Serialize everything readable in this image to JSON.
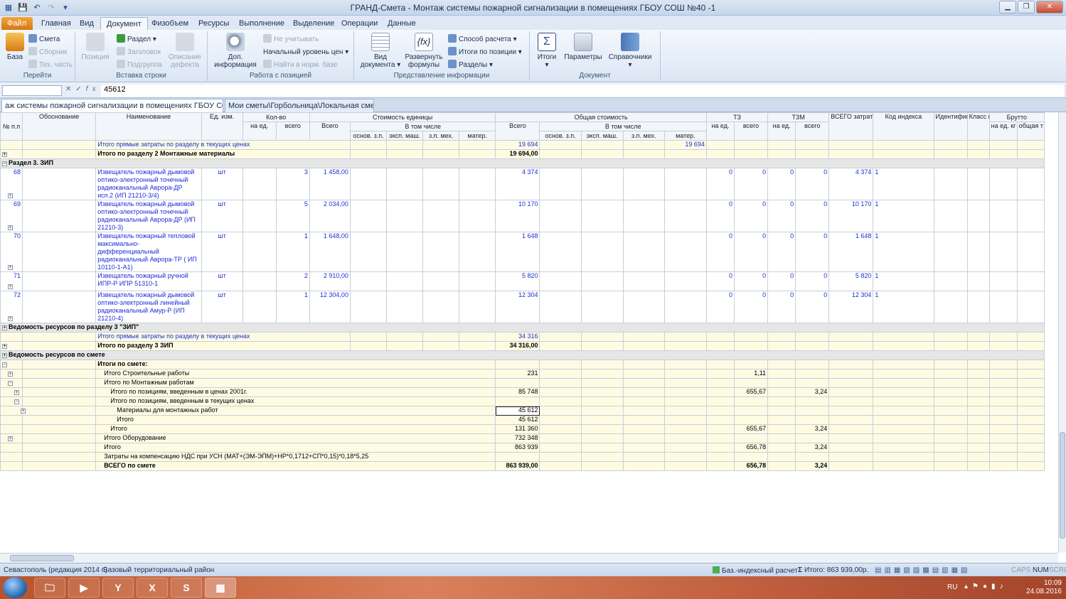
{
  "window": {
    "title": "ГРАНД-Смета - Монтаж системы пожарной сигнализации в помещениях ГБОУ СОШ №40 -1"
  },
  "menu": {
    "tabs": [
      "Файл",
      "Главная",
      "Вид",
      "Документ",
      "Физобъем",
      "Ресурсы",
      "Выполнение",
      "Выделение",
      "Операции",
      "Данные"
    ]
  },
  "ribbon": {
    "go": {
      "title": "Перейти",
      "baza": "База",
      "smeta": "Смета",
      "sbornik": "Сборник",
      "teh": "Тех. часть"
    },
    "insert": {
      "title": "Вставка строки",
      "position": "Позиция",
      "razdel": "Раздел",
      "zagolovok": "Заголовок",
      "podgruppa": "Подгруппа",
      "opisanie1": "Описание",
      "opisanie2": "дефекта"
    },
    "work": {
      "title": "Работа с позицией",
      "dop1": "Доп.",
      "dop2": "информация",
      "neuchit": "Не учитывать",
      "uroven": "Начальный уровень цен",
      "nayti": "Найти в норм. базе"
    },
    "view": {
      "title": "Представление информации",
      "vid1": "Вид",
      "vid2": "документа",
      "razv1": "Развернуть",
      "razv2": "формулы",
      "sposob": "Способ расчета",
      "itogi_pos": "Итоги по позиции",
      "razdely": "Разделы"
    },
    "doc": {
      "title": "Документ",
      "itogi": "Итоги",
      "params": "Параметры",
      "sprav": "Справочники"
    }
  },
  "formula": {
    "value": "45612"
  },
  "doc_tabs": [
    {
      "label": "аж системы пожарной сигнализации в помещениях ГБОУ СОШ №"
    },
    {
      "label": "Мои сметы\\Горбольница\\Локальная смета"
    }
  ],
  "headers": {
    "num": "№ п.п",
    "obosn": "Обоснование",
    "naim": "Наименование",
    "ed": "Ед. изм.",
    "kolvo": "Кол-во",
    "na_ed": "на ед.",
    "vsego": "всего",
    "stoim_ed": "Стоимость единицы",
    "vsego_cap": "Всего",
    "v_tom_chisle": "В том числе",
    "osn_zp": "основ. з.п.",
    "eksp": "эксп. маш.",
    "zp_meh": "з.п. мех.",
    "mater": "матер.",
    "obsh_stoim": "Общая стоимость",
    "tz": "ТЗ",
    "tzm": "ТЗМ",
    "vsego_zatrat": "ВСЕГО затрат",
    "kod": "Код индекса",
    "ident": "Идентификатор",
    "klass": "Класс груза",
    "brutto": "Брутто",
    "na_ed_kg": "на ед. кг",
    "obsh_t": "общая т"
  },
  "rows": [
    {
      "type": "ylw",
      "name": "Итого прямые затраты по разделу в текущих ценах",
      "total": "19 694",
      "mater": "19 694",
      "blue": true
    },
    {
      "type": "bold",
      "toggle": "+",
      "name": "Итого по разделу 2 Монтажные материалы",
      "total": "19 694,00"
    },
    {
      "type": "sect",
      "toggle": "−",
      "name": "Раздел 3. ЗИП"
    },
    {
      "type": "item",
      "num": "68",
      "name": "Извещатель пожарный дымовой оптико-электронный точечный радиоканальный Аврора-ДР исп.2 (ИП 21210-3/4)",
      "ed": "шт",
      "qty": "3",
      "price": "1 458,00",
      "total": "4 374",
      "tz_ed": "0",
      "tz_all": "0",
      "tzm_ed": "0",
      "tzm_all": "0",
      "zatrat": "4 374",
      "kod": "1"
    },
    {
      "type": "item",
      "num": "69",
      "name": "Извещатель пожарный дымовой оптико-электронный точечный радиоканальный Аврора-ДР (ИП 21210-3)",
      "ed": "шт",
      "qty": "5",
      "price": "2 034,00",
      "total": "10 170",
      "tz_ed": "0",
      "tz_all": "0",
      "tzm_ed": "0",
      "tzm_all": "0",
      "zatrat": "10 170",
      "kod": "1"
    },
    {
      "type": "item",
      "num": "70",
      "name": "Извещатель пожарный тепловой максимально-дифференциальный радиоканальный Аврора-ТР ( ИП 10110-1-А1)",
      "ed": "шт",
      "qty": "1",
      "price": "1 648,00",
      "total": "1 648",
      "tz_ed": "0",
      "tz_all": "0",
      "tzm_ed": "0",
      "tzm_all": "0",
      "zatrat": "1 648",
      "kod": "1"
    },
    {
      "type": "item2",
      "num": "71",
      "name": "Извещатель пожарный ручной ИПР-Р ИПР 51310-1",
      "ed": "шт",
      "qty": "2",
      "price": "2 910,00",
      "total": "5 820",
      "tz_ed": "0",
      "tz_all": "0",
      "tzm_ed": "0",
      "tzm_all": "0",
      "zatrat": "5 820",
      "kod": "1"
    },
    {
      "type": "item",
      "num": "72",
      "name": "Извещатель пожарный дымовой оптико-электронный линейный радиоканальный Амур-Р (ИП 21210-4)",
      "ed": "шт",
      "qty": "1",
      "price": "12 304,00",
      "total": "12 304",
      "tz_ed": "0",
      "tz_all": "0",
      "tzm_ed": "0",
      "tzm_all": "0",
      "zatrat": "12 304",
      "kod": "1"
    },
    {
      "type": "sect",
      "toggle": "+",
      "name": "Ведомость ресурсов по разделу 3 \"ЗИП\""
    },
    {
      "type": "ylw",
      "name": "Итого прямые затраты по разделу в текущих ценах",
      "total": "34 316",
      "blue": true
    },
    {
      "type": "bold",
      "toggle": "+",
      "name": "Итого по разделу 3 ЗИП",
      "total": "34 316,00"
    },
    {
      "type": "sect",
      "toggle": "+",
      "name": "Ведомость ресурсов по смете"
    },
    {
      "type": "tot",
      "toggle0": "−",
      "name": "Итоги по смете:",
      "boldname": true,
      "indent": 0
    },
    {
      "type": "tot",
      "toggle": "+",
      "name": "Итого Строительные работы",
      "indent": 1,
      "total": "231",
      "tz_all": "1,11"
    },
    {
      "type": "tot",
      "toggle": "−",
      "name": "Итого по Монтажным работам",
      "indent": 1
    },
    {
      "type": "tot",
      "toggle": "+",
      "name": "Итого по позициям, введенным в ценах 2001г.",
      "indent": 2,
      "total": "85 748",
      "tz_all": "655,67",
      "tzm_all": "3,24"
    },
    {
      "type": "tot",
      "toggle": "−",
      "name": "Итого по позициям, введенным в текущих ценах",
      "indent": 2
    },
    {
      "type": "tot",
      "toggle": "+",
      "name": "Материалы для монтажных работ",
      "indent": 3,
      "total": "45 612",
      "sel": true
    },
    {
      "type": "tot",
      "name": "Итого",
      "indent": 3,
      "total": "45 612"
    },
    {
      "type": "tot",
      "name": "Итого",
      "indent": 2,
      "total": "131 360",
      "tz_all": "655,67",
      "tzm_all": "3,24"
    },
    {
      "type": "tot",
      "toggle": "+",
      "name": "Итого Оборудование",
      "indent": 1,
      "total": "732 348"
    },
    {
      "type": "tot",
      "name": "Итого",
      "indent": 1,
      "total": "863 939",
      "tz_all": "656,78",
      "tzm_all": "3,24"
    },
    {
      "type": "tot",
      "name": "Затраты на компенсацию НДС при УСН (МАТ+(ЭМ-ЭПМ)+НР*0,1712+СП*0,15)*0,18*5,25",
      "indent": 1
    },
    {
      "type": "tot",
      "name": "ВСЕГО по смете",
      "indent": 1,
      "total": "863 939,00",
      "tz_all": "656,78",
      "tzm_all": "3,24",
      "boldall": true
    }
  ],
  "status": {
    "region": "Севастополь (редакция 2014 г.)",
    "base": "Базовый территориальный район",
    "calc": "Баз.-индексный расчет",
    "total": "Итого: 863 939,00р.",
    "caps": "CAPS",
    "num": "NUM",
    "scrl": "SCRL"
  },
  "taskbar": {
    "lang": "RU",
    "time": "10:09",
    "date": "24.08.2016"
  }
}
